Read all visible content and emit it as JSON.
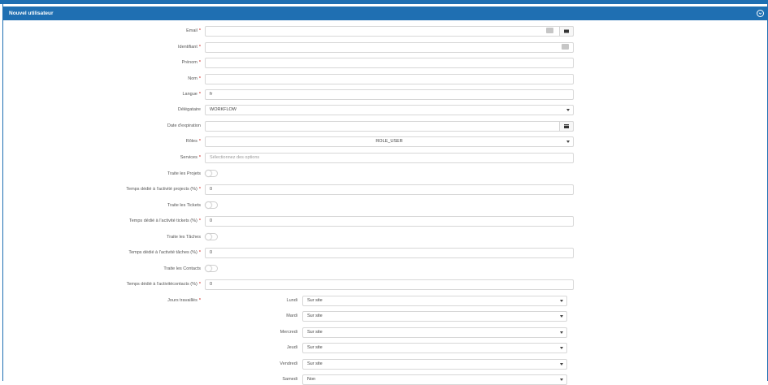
{
  "panel": {
    "title": "Nouvel utilisateur"
  },
  "form": {
    "email": {
      "label": "Email",
      "value": ""
    },
    "identifiant": {
      "label": "Identifiant",
      "value": ""
    },
    "prenom": {
      "label": "Prénom",
      "value": ""
    },
    "nom": {
      "label": "Nom",
      "value": ""
    },
    "langue": {
      "label": "Langue",
      "value": "fr"
    },
    "delegataire": {
      "label": "Délégataire",
      "value": "WORKFLOW"
    },
    "date_expiration": {
      "label": "Date d'expiration",
      "value": ""
    },
    "roles": {
      "label": "Rôles",
      "value": "ROLE_USER"
    },
    "services": {
      "label": "Services",
      "placeholder": "Sélectionnez des options"
    },
    "traite_projets": {
      "label": "Traite les Projets",
      "on": false
    },
    "temps_projets": {
      "label": "Temps dédié à l'activité projects (%)",
      "value": "0"
    },
    "traite_tickets": {
      "label": "Traite les Tickets",
      "on": false
    },
    "temps_tickets": {
      "label": "Temps dédié à l'activité tickets (%)",
      "value": "0"
    },
    "traite_taches": {
      "label": "Traite les Tâches",
      "on": false
    },
    "temps_taches": {
      "label": "Temps dédié à l'activité tâches (%)",
      "value": "0"
    },
    "traite_contacts": {
      "label": "Traite les Contacts",
      "on": false
    },
    "temps_contacts": {
      "label": "Temps dédié à l'activitécontacts (%)",
      "value": "0"
    },
    "jours": {
      "label": "Jours travaillés",
      "days": [
        {
          "label": "Lundi",
          "value": "Sur site"
        },
        {
          "label": "Mardi",
          "value": "Sur site"
        },
        {
          "label": "Mercredi",
          "value": "Sur site"
        },
        {
          "label": "Jeudi",
          "value": "Sur site"
        },
        {
          "label": "Vendredi",
          "value": "Sur site"
        },
        {
          "label": "Samedi",
          "value": "Non"
        }
      ]
    },
    "required_mark": "*"
  },
  "colors": {
    "primary": "#1f6fb2",
    "required": "#d9534f"
  }
}
